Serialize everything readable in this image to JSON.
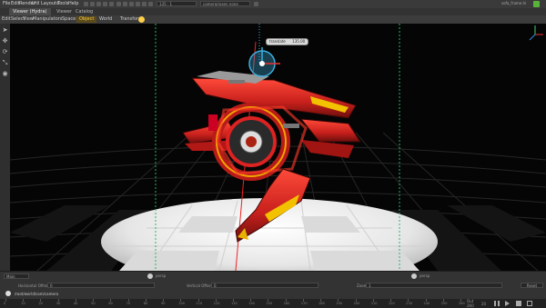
{
  "menu": [
    "File",
    "Edit",
    "Render",
    "Util",
    "Layouts",
    "Tools",
    "Help"
  ],
  "toolbar": {
    "frame_field": "135  : 1",
    "selection_field": "camera/rosen  none",
    "user": "sofa_frame.hi"
  },
  "tabs": [
    {
      "label": "Viewer (Hydra)",
      "active": true
    },
    {
      "label": "Viewer",
      "active": false
    },
    {
      "label": "Catalog",
      "active": false
    }
  ],
  "toolbar2": {
    "items": [
      "Edit",
      "Select",
      "View",
      "Manipulators",
      "Space:",
      "Object",
      "World",
      "Transform"
    ],
    "active": "Object"
  },
  "left_tools": [
    "arrow-icon",
    "move-icon",
    "rotate-icon",
    "scale-icon",
    "camera-icon"
  ],
  "viewport": {
    "gizmo_readout_left": "translate",
    "gizmo_readout_right": "135.00"
  },
  "bottom": {
    "camera_select": "Main",
    "camera_name_1": "persp",
    "camera_name_2": "persp",
    "horizontal_offset_label": "Horizontal Offset",
    "horizontal_offset_value": "0",
    "vertical_offset_label": "Vertical Offset",
    "vertical_offset_value": "0",
    "zoom_label": "Zoom",
    "zoom_value": "1",
    "path": "/root/world/cam/camera",
    "reset_label": "Reset"
  },
  "timeline": {
    "ticks": [
      "0",
      "10",
      "20",
      "30",
      "40",
      "50",
      "60",
      "70",
      "80",
      "90",
      "100",
      "110",
      "120",
      "130",
      "140",
      "150",
      "160",
      "170",
      "180",
      "190",
      "200",
      "210",
      "220",
      "230",
      "240",
      "250",
      "260"
    ],
    "out_label": "Out",
    "out_value": "260",
    "in_value": "20"
  },
  "colors": {
    "accent": "#ffcf4a",
    "gizmo": "#3bb0e0",
    "ship_red": "#c8201c",
    "guide_green": "#29b36b"
  }
}
